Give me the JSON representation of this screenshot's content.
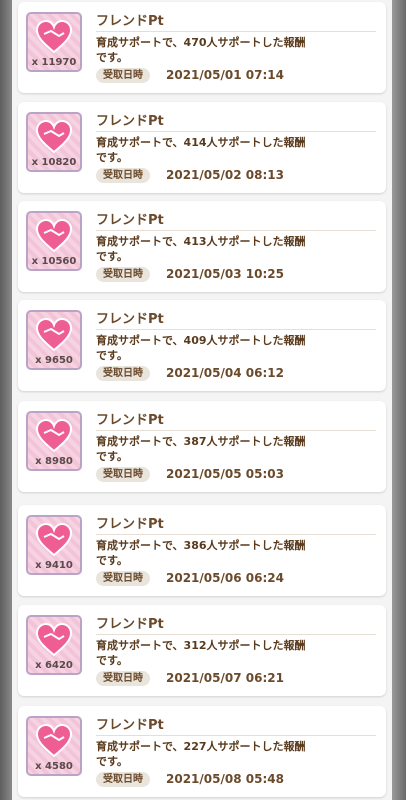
{
  "item_name": "フレンドPt",
  "date_label": "受取日時",
  "entries": [
    {
      "qty": "x 11970",
      "desc": "育成サポートで、470人サポートした報酬です。",
      "date": "2021/05/01 07:14"
    },
    {
      "qty": "x 10820",
      "desc": "育成サポートで、414人サポートした報酬です。",
      "date": "2021/05/02 08:13"
    },
    {
      "qty": "x 10560",
      "desc": "育成サポートで、413人サポートした報酬です。",
      "date": "2021/05/03 10:25"
    },
    {
      "qty": "x 9650",
      "desc": "育成サポートで、409人サポートした報酬です。",
      "date": "2021/05/04 06:12"
    },
    {
      "qty": "x 8980",
      "desc": "育成サポートで、387人サポートした報酬です。",
      "date": "2021/05/05 05:03"
    },
    {
      "qty": "x 9410",
      "desc": "育成サポートで、386人サポートした報酬です。",
      "date": "2021/05/06 06:24"
    },
    {
      "qty": "x 6420",
      "desc": "育成サポートで、312人サポートした報酬です。",
      "date": "2021/05/07 06:21"
    },
    {
      "qty": "x 4580",
      "desc": "育成サポートで、227人サポートした報酬です。",
      "date": "2021/05/08 05:48"
    }
  ],
  "icon": "friend-point-icon"
}
